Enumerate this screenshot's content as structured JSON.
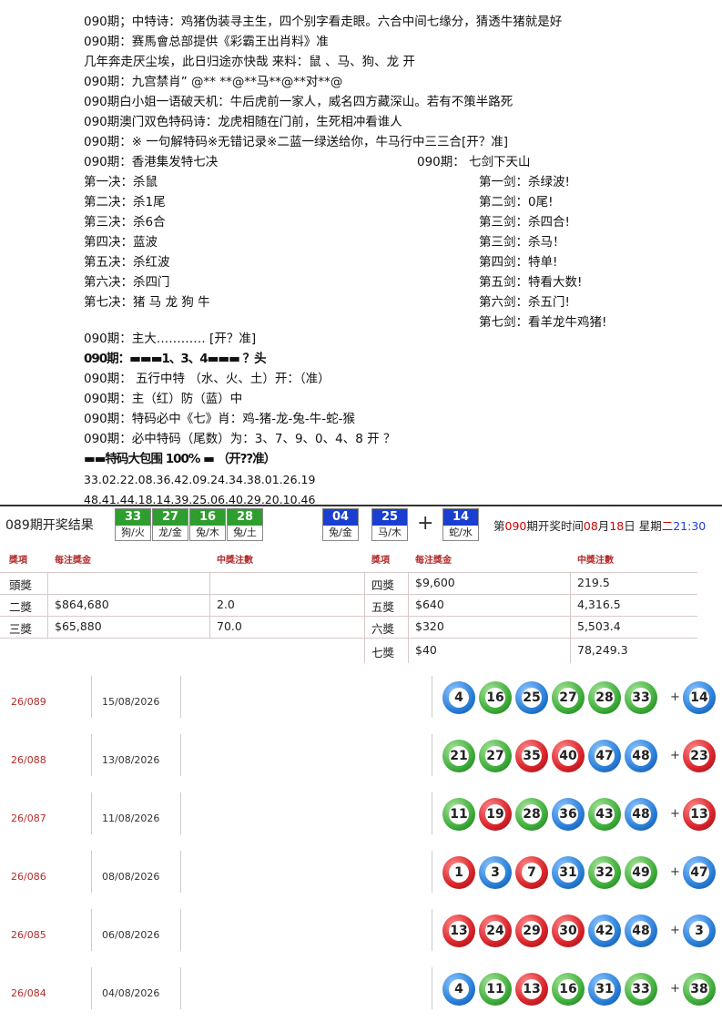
{
  "lines": [
    "090期；中特诗：鸡猪伪装寻主生，四个别字看走眼。六合中间七缘分，猜透牛猪就是好",
    "090期：赛馬會总部提供《彩霸王出肖料》准",
    "几年奔走厌尘埃，此日归途亦快哉 来料：鼠 、马、狗、龙   开",
    "090期：九宫禁肖” @** **@**马**@**对**@",
    "090期白小姐一语破天机：牛后虎前一家人，威名四方藏深山。若有不策半路死",
    "090期澳门双色特码诗：龙虎相随在门前，生死相冲看谁人",
    "090期：※ 一句解特码※无错记录※二蓝一绿送给你，牛马行中三三合[开？准]"
  ],
  "left_head": "090期：香港集发特七决",
  "right_head": "090期： 七剑下天山",
  "left_items": [
    "第一决：杀鼠",
    "第二决：杀1尾",
    "第三决：杀6合",
    "第四决：蓝波",
    "第五决：杀红波",
    "第六决：杀四门",
    "第七决：猪 马 龙 狗 牛"
  ],
  "right_items": [
    "第一剑：杀绿波!",
    "第二剑：0尾!",
    "第三剑：杀四合!",
    "第三剑：杀马！",
    "第四剑：特单!",
    "第五剑：特看大数!",
    "第六剑：杀五门!",
    "第七剑：看羊龙牛鸡猪!"
  ],
  "lines2": [
    "090期：主大………… [开？准]",
    "090期：▬▬▬1、3、4▬▬▬ ？头",
    "090期： 五行中特  （水、火、土）开：（准）",
    "090期：主（红）防（蓝）中",
    "090期：特码必中《七》肖：鸡-猪-龙-兔-牛-蛇-猴",
    "090期：必中特码（尾数）为：3、7、9、0、4、8  开 ？",
    "▬▬特码大包围 100% ▬ （开??准）"
  ],
  "nums_line1": "33.02.22.08.36.42.09.24.34.38.01.26.19",
  "nums_line2": "48.41.44.18.14.39.25.06.40.29.20.10.46",
  "result": {
    "title": "089期开奖结果",
    "balls": [
      {
        "num": "33",
        "sub": "狗/火",
        "color": "#2e9e2e"
      },
      {
        "num": "27",
        "sub": "龙/金",
        "color": "#2e9e2e"
      },
      {
        "num": "16",
        "sub": "兔/木",
        "color": "#2e9e2e"
      },
      {
        "num": "28",
        "sub": "兔/土",
        "color": "#2e9e2e"
      },
      {
        "num": "04",
        "sub": "兔/金",
        "color": "#1a3fd0"
      },
      {
        "num": "25",
        "sub": "马/木",
        "color": "#1a3fd0"
      }
    ],
    "plus": "+",
    "special": {
      "num": "14",
      "sub": "蛇/水",
      "color": "#1a3fd0"
    },
    "info_pre": "第",
    "info_issue": "090",
    "info_mid": "期开奖时间",
    "info_month": "08",
    "info_m": "月",
    "info_day": "18",
    "info_d": "日 星期",
    "info_weekday": "二",
    "info_time": "21:30"
  },
  "prize": {
    "headers": [
      "獎項",
      "每注獎金",
      "中獎注數",
      "獎項",
      "每注獎金",
      "中獎注數"
    ],
    "left": [
      {
        "name": "頭獎",
        "amount": "",
        "count": ""
      },
      {
        "name": "二獎",
        "amount": "$864,680",
        "count": "2.0"
      },
      {
        "name": "三獎",
        "amount": "$65,880",
        "count": "70.0"
      }
    ],
    "right": [
      {
        "name": "四獎",
        "amount": "$9,600",
        "count": "219.5"
      },
      {
        "name": "五獎",
        "amount": "$640",
        "count": "4,316.5"
      },
      {
        "name": "六獎",
        "amount": "$320",
        "count": "5,503.4"
      },
      {
        "name": "七獎",
        "amount": "$40",
        "count": "78,249.3"
      }
    ]
  },
  "history": [
    {
      "issue": "26/089",
      "date": "15/08/2026",
      "balls": [
        [
          "4",
          "blue"
        ],
        [
          "16",
          "green"
        ],
        [
          "25",
          "blue"
        ],
        [
          "27",
          "green"
        ],
        [
          "28",
          "green"
        ],
        [
          "33",
          "green"
        ]
      ],
      "special": [
        "14",
        "blue"
      ]
    },
    {
      "issue": "26/088",
      "date": "13/08/2026",
      "balls": [
        [
          "21",
          "green"
        ],
        [
          "27",
          "green"
        ],
        [
          "35",
          "red"
        ],
        [
          "40",
          "red"
        ],
        [
          "47",
          "blue"
        ],
        [
          "48",
          "blue"
        ]
      ],
      "special": [
        "23",
        "red"
      ]
    },
    {
      "issue": "26/087",
      "date": "11/08/2026",
      "balls": [
        [
          "11",
          "green"
        ],
        [
          "19",
          "red"
        ],
        [
          "28",
          "green"
        ],
        [
          "36",
          "blue"
        ],
        [
          "43",
          "green"
        ],
        [
          "48",
          "blue"
        ]
      ],
      "special": [
        "13",
        "red"
      ]
    },
    {
      "issue": "26/086",
      "date": "08/08/2026",
      "balls": [
        [
          "1",
          "red"
        ],
        [
          "3",
          "blue"
        ],
        [
          "7",
          "red"
        ],
        [
          "31",
          "blue"
        ],
        [
          "32",
          "green"
        ],
        [
          "49",
          "green"
        ]
      ],
      "special": [
        "47",
        "blue"
      ]
    },
    {
      "issue": "26/085",
      "date": "06/08/2026",
      "balls": [
        [
          "13",
          "red"
        ],
        [
          "24",
          "red"
        ],
        [
          "29",
          "red"
        ],
        [
          "30",
          "red"
        ],
        [
          "42",
          "blue"
        ],
        [
          "48",
          "blue"
        ]
      ],
      "special": [
        "3",
        "blue"
      ]
    },
    {
      "issue": "26/084",
      "date": "04/08/2026",
      "balls": [
        [
          "4",
          "blue"
        ],
        [
          "11",
          "green"
        ],
        [
          "13",
          "red"
        ],
        [
          "16",
          "green"
        ],
        [
          "31",
          "blue"
        ],
        [
          "33",
          "green"
        ]
      ],
      "special": [
        "38",
        "green"
      ]
    }
  ],
  "history_plus": "+"
}
